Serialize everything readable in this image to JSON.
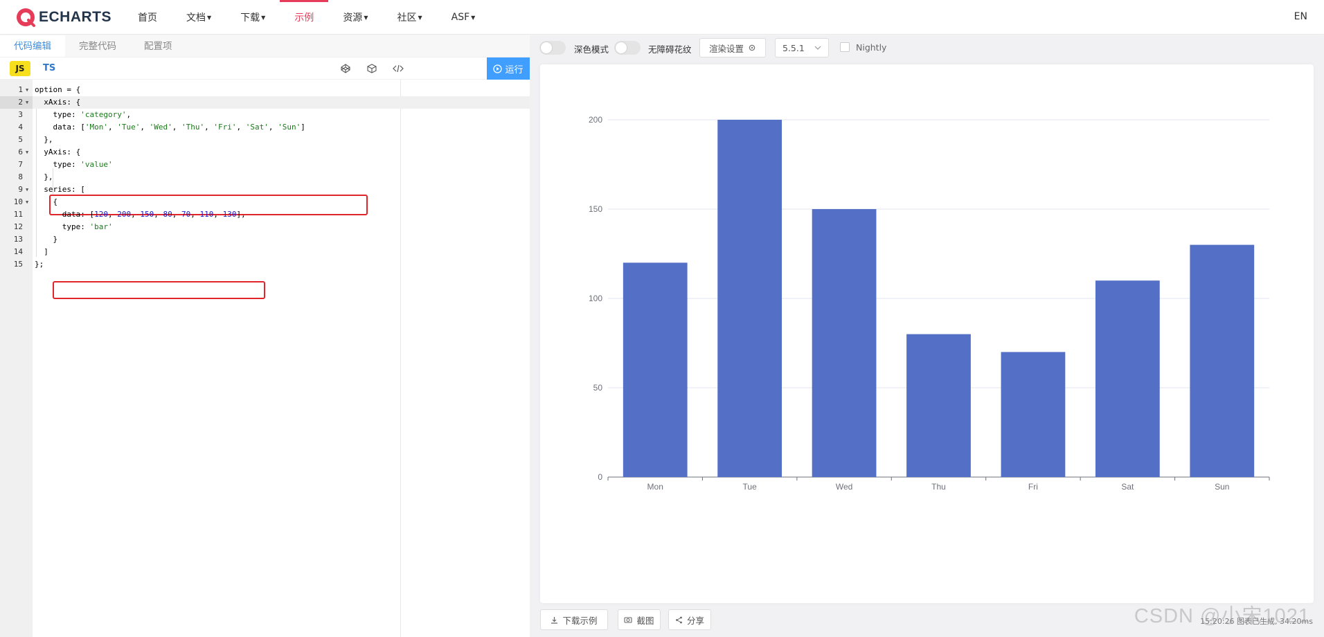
{
  "nav": {
    "logo_text": "ECHARTS",
    "items": [
      {
        "label": "首页",
        "caret": false,
        "active": false
      },
      {
        "label": "文档",
        "caret": true,
        "active": false
      },
      {
        "label": "下载",
        "caret": true,
        "active": false
      },
      {
        "label": "示例",
        "caret": false,
        "active": true
      },
      {
        "label": "资源",
        "caret": true,
        "active": false
      },
      {
        "label": "社区",
        "caret": true,
        "active": false
      },
      {
        "label": "ASF",
        "caret": true,
        "active": false
      }
    ],
    "lang": "EN",
    "accent_color": "#e43c59"
  },
  "editor": {
    "tabs": [
      {
        "label": "代码编辑",
        "active": true
      },
      {
        "label": "完整代码",
        "active": false
      },
      {
        "label": "配置项",
        "active": false
      }
    ],
    "lang_js": "JS",
    "lang_ts": "TS",
    "tool_icons": [
      "codepen-icon",
      "codesandbox-icon",
      "embed-code-icon"
    ],
    "run_label": "运行",
    "current_line": 2,
    "lines": [
      {
        "n": "1",
        "fold": true,
        "html": "option = {"
      },
      {
        "n": "2",
        "fold": true,
        "html": "  xAxis: {"
      },
      {
        "n": "3",
        "fold": false,
        "html": "    type: <span class=\"s\">'category'</span>,"
      },
      {
        "n": "4",
        "fold": false,
        "html": "    data: [<span class=\"s\">'Mon'</span>, <span class=\"s\">'Tue'</span>, <span class=\"s\">'Wed'</span>, <span class=\"s\">'Thu'</span>, <span class=\"s\">'Fri'</span>, <span class=\"s\">'Sat'</span>, <span class=\"s\">'Sun'</span>]"
      },
      {
        "n": "5",
        "fold": false,
        "html": "  },"
      },
      {
        "n": "6",
        "fold": true,
        "html": "  yAxis: {"
      },
      {
        "n": "7",
        "fold": false,
        "html": "    type: <span class=\"s\">'value'</span>"
      },
      {
        "n": "8",
        "fold": false,
        "html": "  },"
      },
      {
        "n": "9",
        "fold": true,
        "html": "  series: ["
      },
      {
        "n": "10",
        "fold": true,
        "html": "    {"
      },
      {
        "n": "11",
        "fold": false,
        "html": "      data: [<span class=\"n\">120</span>, <span class=\"n\">200</span>, <span class=\"n\">150</span>, <span class=\"n\">80</span>, <span class=\"n\">70</span>, <span class=\"n\">110</span>, <span class=\"n\">130</span>],"
      },
      {
        "n": "12",
        "fold": false,
        "html": "      type: <span class=\"s\">'bar'</span>"
      },
      {
        "n": "13",
        "fold": false,
        "html": "    }"
      },
      {
        "n": "14",
        "fold": false,
        "html": "  ]"
      },
      {
        "n": "15",
        "fold": false,
        "html": "};"
      }
    ]
  },
  "preview": {
    "dark_mode_label": "深色模式",
    "aria_label": "无障碍花纹",
    "render_settings_label": "渲染设置",
    "version": "5.5.1",
    "nightly_label": "Nightly",
    "download_label": "下载示例",
    "screenshot_label": "截图",
    "share_label": "分享",
    "status_text": "15:20:26  图表已生成, 34.20ms",
    "watermark": "CSDN @小宋1021"
  },
  "chart_data": {
    "type": "bar",
    "categories": [
      "Mon",
      "Tue",
      "Wed",
      "Thu",
      "Fri",
      "Sat",
      "Sun"
    ],
    "values": [
      120,
      200,
      150,
      80,
      70,
      110,
      130
    ],
    "ylim": [
      0,
      200
    ],
    "yticks": [
      0,
      50,
      100,
      150,
      200
    ],
    "bar_color": "#5470c6",
    "grid": true
  }
}
